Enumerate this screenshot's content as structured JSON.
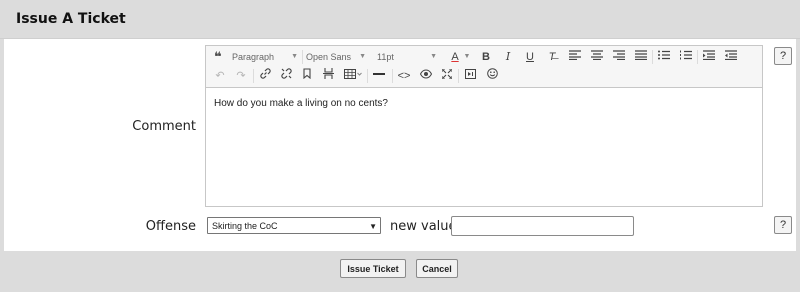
{
  "title": "Issue A Ticket",
  "comment": {
    "label": "Comment",
    "help": "?",
    "text": "How do you make a living on no cents?"
  },
  "toolbar": {
    "format_value": "Paragraph",
    "font_value": "Open Sans",
    "size_value": "11pt"
  },
  "offense": {
    "label": "Offense",
    "help": "?",
    "selected": "Skirting the CoC",
    "new_value_label": "new value",
    "new_value": ""
  },
  "buttons": {
    "issue": "Issue Ticket",
    "cancel": "Cancel"
  }
}
